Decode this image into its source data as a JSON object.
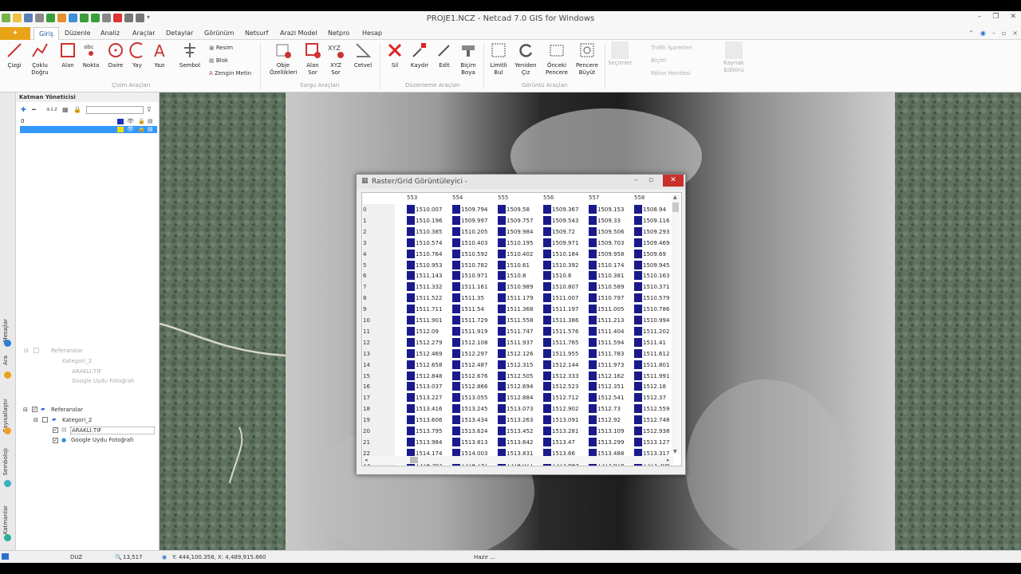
{
  "window": {
    "title": "PROJE1.NCZ - Netcad 7.0 GIS for Windows",
    "controls": [
      "–",
      "❐",
      "✕"
    ]
  },
  "ribbon_tabs": {
    "file": "✦",
    "items": [
      "Giriş",
      "Düzenle",
      "Analiz",
      "Araçlar",
      "Detaylar",
      "Görünüm",
      "Netsurf",
      "Arazi Model",
      "Netpro",
      "Hesap"
    ],
    "active": "Giriş"
  },
  "ribbon": {
    "cizim": {
      "cizgi": "Çizgi",
      "coklu_dogru": "Çoklu Doğru",
      "alan": "Alan",
      "nokta": "Nokta",
      "daire": "Daire",
      "yay": "Yay",
      "yazi": "Yazı",
      "sembol": "Sembol",
      "resim": "Resim",
      "blok": "Blok",
      "zengin_metin": "Zengin Metin",
      "group": "Çizim Araçları"
    },
    "sorgu": {
      "obje_ozellikleri": "Obje Özellikleri",
      "alan_sor": "Alan Sor",
      "xyz_sor": "XYZ Sor",
      "cetvel": "Cetvel",
      "group": "Sorgu Araçları"
    },
    "duzenleme": {
      "sil": "Sil",
      "kaydir": "Kaydır",
      "edit": "Edit",
      "bicim_boya": "Biçim Boya",
      "group": "Düzenleme Araçları"
    },
    "goruntu": {
      "limitli_bul": "Limitli Bul",
      "yeniden_ciz": "Yeniden Çiz",
      "onceki_pencere": "Önceki Pencere",
      "pencere_buyut": "Pencere Büyüt",
      "group": "Görüntü Araçları"
    },
    "other": {
      "tafik_isaretleri": "Trafik İşaretleri",
      "bicim": "Biçim",
      "relief": "Rölve Hendesi",
      "kaynak_editoru": "Kaynak Editörü",
      "seconds": "Seçimler"
    }
  },
  "layer_manager": {
    "title": "Katman Yöneticisi",
    "layers": [
      {
        "name": "0",
        "color": "#1f2fb5"
      },
      {
        "name": "",
        "color": "#f0e000",
        "selected": true
      }
    ]
  },
  "tree_dim": {
    "root": "Referanslar",
    "category": "Kategori_2",
    "items": [
      "ARAKLI.TIF",
      "Google Uydu Fotoğrafı"
    ]
  },
  "tree": {
    "root": "Referanslar",
    "category": "Kategori_2",
    "items": [
      "ARAKLI.TIF",
      "Google Uydu Fotoğrafı"
    ]
  },
  "side_tabs": [
    "Mesajlar",
    "Ara",
    "Sayısallaştır",
    "Sembolojı",
    "Katmanlar"
  ],
  "dialog": {
    "title": "Raster/Grid Görüntüleyici -",
    "columns": [
      "553",
      "554",
      "555",
      "556",
      "557",
      "558"
    ],
    "rows": [
      {
        "id": "0",
        "v": [
          "1510.007",
          "1509.794",
          "1509.58",
          "1509.367",
          "1509.153",
          "1508.94"
        ]
      },
      {
        "id": "1",
        "v": [
          "1510.196",
          "1509.997",
          "1509.757",
          "1509.543",
          "1509.33",
          "1509.116"
        ]
      },
      {
        "id": "2",
        "v": [
          "1510.385",
          "1510.205",
          "1509.984",
          "1509.72",
          "1509.506",
          "1509.293"
        ]
      },
      {
        "id": "3",
        "v": [
          "1510.574",
          "1510.403",
          "1510.195",
          "1509.971",
          "1509.703",
          "1509.469"
        ]
      },
      {
        "id": "4",
        "v": [
          "1510.764",
          "1510.592",
          "1510.402",
          "1510.184",
          "1509.958",
          "1509.69"
        ]
      },
      {
        "id": "5",
        "v": [
          "1510.953",
          "1510.782",
          "1510.61",
          "1510.392",
          "1510.174",
          "1509.945"
        ]
      },
      {
        "id": "6",
        "v": [
          "1511.143",
          "1510.971",
          "1510.8",
          "1510.6",
          "1510.381",
          "1510.163"
        ]
      },
      {
        "id": "7",
        "v": [
          "1511.332",
          "1511.161",
          "1510.989",
          "1510.807",
          "1510.589",
          "1510.371"
        ]
      },
      {
        "id": "8",
        "v": [
          "1511.522",
          "1511.35",
          "1511.179",
          "1511.007",
          "1510.797",
          "1510.579"
        ]
      },
      {
        "id": "9",
        "v": [
          "1511.711",
          "1511.54",
          "1511.368",
          "1511.197",
          "1511.005",
          "1510.786"
        ]
      },
      {
        "id": "10",
        "v": [
          "1511.901",
          "1511.729",
          "1511.558",
          "1511.386",
          "1511.213",
          "1510.994"
        ]
      },
      {
        "id": "11",
        "v": [
          "1512.09",
          "1511.919",
          "1511.747",
          "1511.576",
          "1511.404",
          "1511.202"
        ]
      },
      {
        "id": "12",
        "v": [
          "1512.279",
          "1512.108",
          "1511.937",
          "1511.765",
          "1511.594",
          "1511.41"
        ]
      },
      {
        "id": "13",
        "v": [
          "1512.469",
          "1512.297",
          "1512.126",
          "1511.955",
          "1511.783",
          "1511.612"
        ]
      },
      {
        "id": "14",
        "v": [
          "1512.658",
          "1512.487",
          "1512.315",
          "1512.144",
          "1511.973",
          "1511.801"
        ]
      },
      {
        "id": "15",
        "v": [
          "1512.848",
          "1512.676",
          "1512.505",
          "1512.333",
          "1512.162",
          "1511.991"
        ]
      },
      {
        "id": "16",
        "v": [
          "1513.037",
          "1512.866",
          "1512.694",
          "1512.523",
          "1512.351",
          "1512.18"
        ]
      },
      {
        "id": "17",
        "v": [
          "1513.227",
          "1513.055",
          "1512.884",
          "1512.712",
          "1512.541",
          "1512.37"
        ]
      },
      {
        "id": "18",
        "v": [
          "1513.416",
          "1513.245",
          "1513.073",
          "1512.902",
          "1512.73",
          "1512.559"
        ]
      },
      {
        "id": "19",
        "v": [
          "1513.606",
          "1513.434",
          "1513.263",
          "1513.091",
          "1512.92",
          "1512.748"
        ]
      },
      {
        "id": "20",
        "v": [
          "1513.795",
          "1513.624",
          "1513.452",
          "1513.281",
          "1513.109",
          "1512.938"
        ]
      },
      {
        "id": "21",
        "v": [
          "1513.984",
          "1513.813",
          "1513.642",
          "1513.47",
          "1513.299",
          "1513.127"
        ]
      },
      {
        "id": "22",
        "v": [
          "1514.174",
          "1514.003",
          "1513.831",
          "1513.66",
          "1513.488",
          "1513.317"
        ]
      },
      {
        "id": "23",
        "v": [
          "1514.363",
          "1514.192",
          "1514.021",
          "1513.849",
          "1513.678",
          "1513.506"
        ]
      }
    ]
  },
  "status": {
    "mode": "DUZ",
    "scale": "13,517",
    "coords": "Y: 444,100.358, X: 4,489,915.860",
    "ready": "Hazır ..."
  }
}
